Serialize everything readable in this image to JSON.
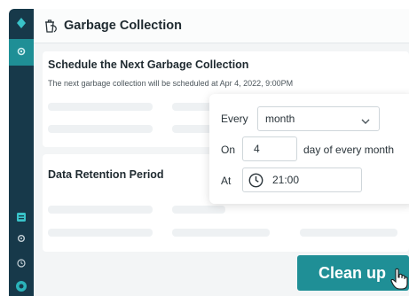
{
  "sidebar": {
    "icons": [
      "diamond-logo-icon",
      "gear-icon",
      "grid-icon",
      "settings-icon",
      "clock-icon",
      "user-icon"
    ]
  },
  "header": {
    "title": "Garbage Collection",
    "icon": "trash-hand-icon"
  },
  "schedule_card": {
    "title": "Schedule the Next Garbage Collection",
    "subtitle": "The next garbage collection will be scheduled at Apr 4, 2022, 9:00PM"
  },
  "retention_card": {
    "title": "Data Retention Period"
  },
  "popover": {
    "every_label": "Every",
    "every_value": "month",
    "on_label": "On",
    "day_value": "4",
    "day_suffix": "day of every month",
    "at_label": "At",
    "time_value": "21:00"
  },
  "actions": {
    "cleanup_label": "Clean up"
  },
  "colors": {
    "sidebar": "#17394a",
    "accent": "#1f8f96"
  }
}
